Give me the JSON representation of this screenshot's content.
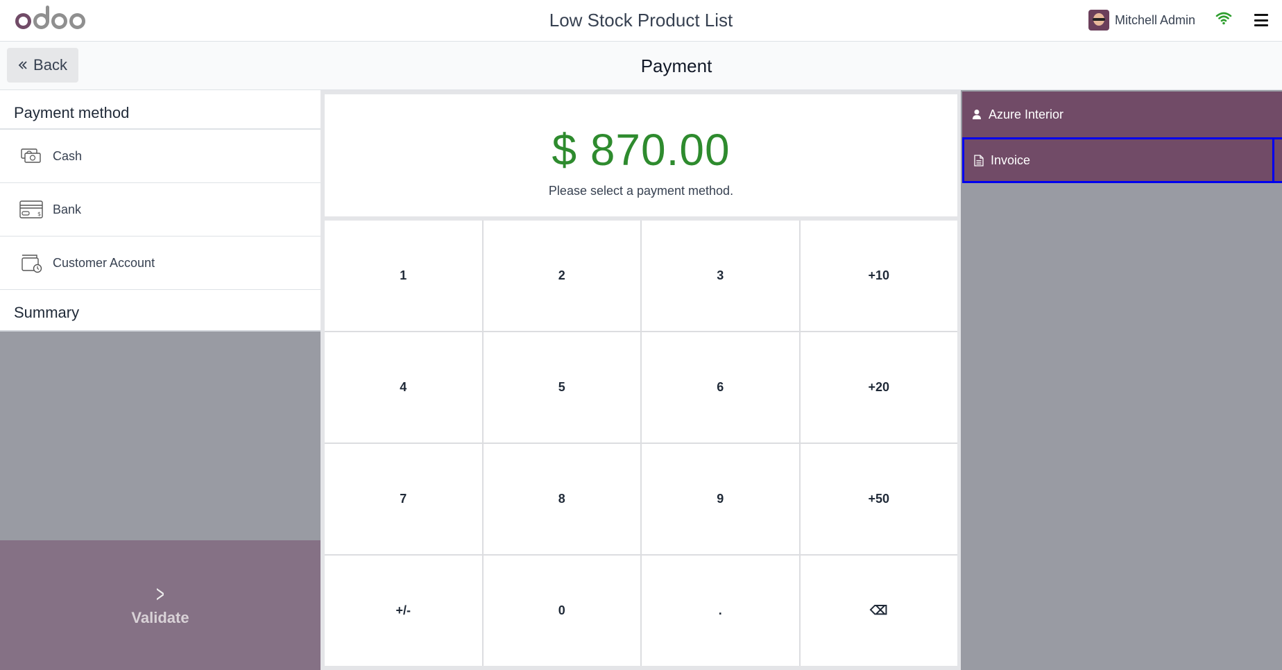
{
  "header": {
    "logo_text": "odoo",
    "title": "Low Stock Product List",
    "user_name": "Mitchell Admin",
    "icons": [
      "user-avatar",
      "wifi-icon",
      "hamburger-menu-icon"
    ]
  },
  "subheader": {
    "back_label": "Back",
    "title": "Payment"
  },
  "left": {
    "payment_method_title": "Payment method",
    "methods": [
      {
        "label": "Cash",
        "icon": "cash-icon"
      },
      {
        "label": "Bank",
        "icon": "bank-card-icon"
      },
      {
        "label": "Customer Account",
        "icon": "customer-account-icon"
      }
    ],
    "summary_title": "Summary",
    "validate_label": "Validate"
  },
  "center": {
    "amount": "$ 870.00",
    "message": "Please select a payment method.",
    "keys": [
      "1",
      "2",
      "3",
      "+10",
      "4",
      "5",
      "6",
      "+20",
      "7",
      "8",
      "9",
      "+50",
      "+/-",
      "0",
      ".",
      "⌫"
    ]
  },
  "right": {
    "customer_label": "Azure Interior",
    "invoice_label": "Invoice"
  },
  "colors": {
    "brand": "#714b67",
    "amount": "#2e8b2e",
    "panel_gray": "#999ba3",
    "validate_bg": "#857185",
    "focus_outline": "#0000ee"
  }
}
